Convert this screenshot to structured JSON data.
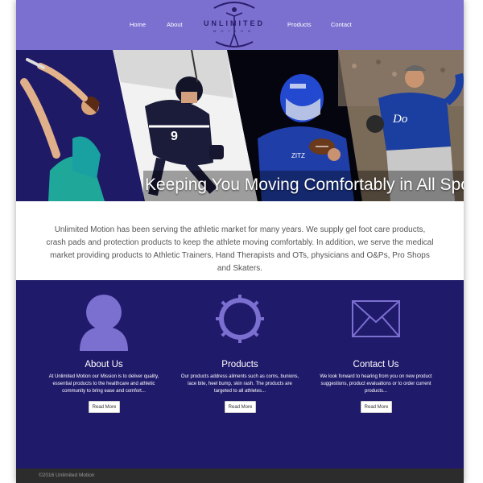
{
  "colors": {
    "nav_bg": "#7b6fd0",
    "feature_bg": "#201a6b",
    "icon_color": "#7b6fd0",
    "footer_bg": "#2c2c2c"
  },
  "nav": {
    "items": [
      {
        "label": "Home"
      },
      {
        "label": "About"
      },
      {
        "label": "Products"
      },
      {
        "label": "Contact"
      }
    ],
    "logo_text": "UNLIMITED",
    "logo_sub": "MOTION"
  },
  "hero": {
    "tagline": "Keeping You Moving Comfortably in All Sports",
    "panels": [
      "figure-skater",
      "hockey-player",
      "football-quarterback",
      "baseball-pitcher"
    ],
    "jersey_numbers": [
      "9",
      "ZITZ",
      "Do"
    ]
  },
  "intro": {
    "text": "Unlimited Motion has been serving the athletic market for many years. We supply gel foot care products, crash pads and protection products to keep the athlete moving comfortably. In addition, we serve the medical market providing products to Athletic Trainers, Hand Therapists and OTs, physicians and O&Ps, Pro Shops and Skaters."
  },
  "features": [
    {
      "icon": "person-icon",
      "title": "About Us",
      "text": "At Unlimited Motion our Mission is to deliver quality, essential products to the healthcare and athletic community to bring ease and comfort...",
      "button": "Read More"
    },
    {
      "icon": "gear-icon",
      "title": "Products",
      "text": "Our products address ailments such as corns, bunions, lace bite, heel bump, skin rash. The products are targeted to all athletes...",
      "button": "Read More"
    },
    {
      "icon": "envelope-icon",
      "title": "Contact Us",
      "text": "We look forward to hearing from you on new product suggestions, product evaluations or to order current products...",
      "button": "Read More"
    }
  ],
  "footer": {
    "text": "©2016 Unlimited Motion"
  }
}
